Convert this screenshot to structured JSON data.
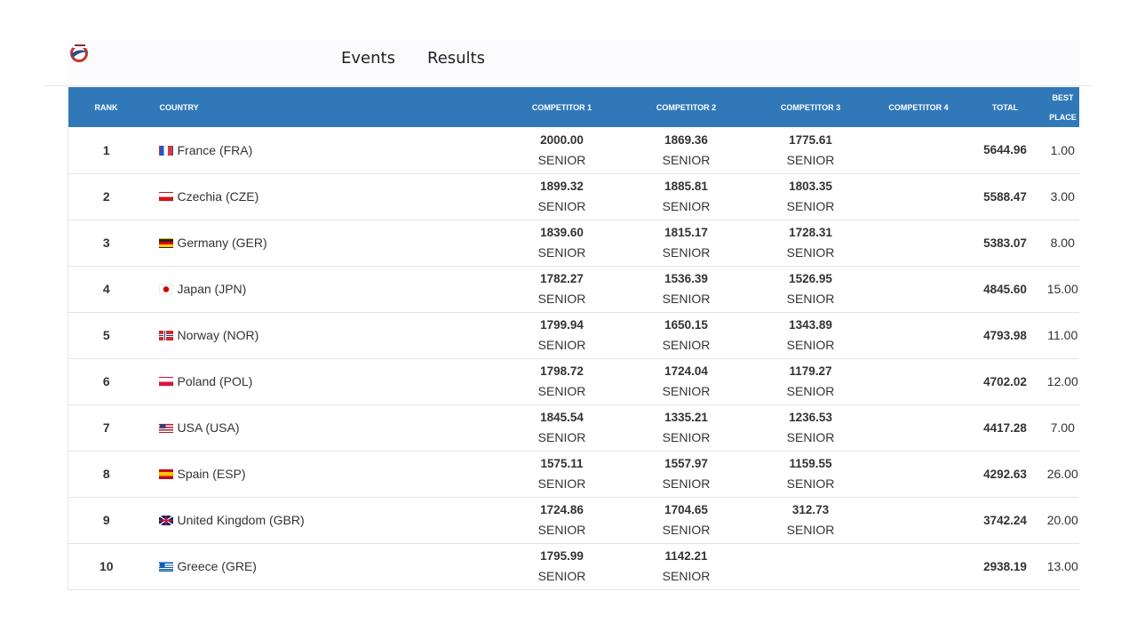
{
  "nav": {
    "logo_icon": "association-logo-icon",
    "events_label": "Events",
    "results_label": "Results"
  },
  "table": {
    "headers": {
      "rank": "RANK",
      "country": "COUNTRY",
      "competitor1": "COMPETITOR 1",
      "competitor2": "COMPETITOR 2",
      "competitor3": "COMPETITOR 3",
      "competitor4": "COMPETITOR 4",
      "total": "TOTAL",
      "best_line1": "BEST",
      "best_line2": "PLACE"
    },
    "header_color": "#3178b9",
    "rows": [
      {
        "rank": "1",
        "country": "France (FRA)",
        "flag": "flag-france-icon",
        "c1": {
          "score": "2000.00",
          "level": "SENIOR"
        },
        "c2": {
          "score": "1869.36",
          "level": "SENIOR"
        },
        "c3": {
          "score": "1775.61",
          "level": "SENIOR"
        },
        "total": "5644.96",
        "best": "1.00"
      },
      {
        "rank": "2",
        "country": "Czechia (CZE)",
        "flag": "flag-czechia-icon",
        "c1": {
          "score": "1899.32",
          "level": "SENIOR"
        },
        "c2": {
          "score": "1885.81",
          "level": "SENIOR"
        },
        "c3": {
          "score": "1803.35",
          "level": "SENIOR"
        },
        "total": "5588.47",
        "best": "3.00"
      },
      {
        "rank": "3",
        "country": "Germany (GER)",
        "flag": "flag-germany-icon",
        "c1": {
          "score": "1839.60",
          "level": "SENIOR"
        },
        "c2": {
          "score": "1815.17",
          "level": "SENIOR"
        },
        "c3": {
          "score": "1728.31",
          "level": "SENIOR"
        },
        "total": "5383.07",
        "best": "8.00"
      },
      {
        "rank": "4",
        "country": "Japan (JPN)",
        "flag": "flag-japan-icon",
        "c1": {
          "score": "1782.27",
          "level": "SENIOR"
        },
        "c2": {
          "score": "1536.39",
          "level": "SENIOR"
        },
        "c3": {
          "score": "1526.95",
          "level": "SENIOR"
        },
        "total": "4845.60",
        "best": "15.00"
      },
      {
        "rank": "5",
        "country": "Norway (NOR)",
        "flag": "flag-norway-icon",
        "c1": {
          "score": "1799.94",
          "level": "SENIOR"
        },
        "c2": {
          "score": "1650.15",
          "level": "SENIOR"
        },
        "c3": {
          "score": "1343.89",
          "level": "SENIOR"
        },
        "total": "4793.98",
        "best": "11.00"
      },
      {
        "rank": "6",
        "country": "Poland (POL)",
        "flag": "flag-poland-icon",
        "c1": {
          "score": "1798.72",
          "level": "SENIOR"
        },
        "c2": {
          "score": "1724.04",
          "level": "SENIOR"
        },
        "c3": {
          "score": "1179.27",
          "level": "SENIOR"
        },
        "total": "4702.02",
        "best": "12.00"
      },
      {
        "rank": "7",
        "country": "USA (USA)",
        "flag": "flag-usa-icon",
        "c1": {
          "score": "1845.54",
          "level": "SENIOR"
        },
        "c2": {
          "score": "1335.21",
          "level": "SENIOR"
        },
        "c3": {
          "score": "1236.53",
          "level": "SENIOR"
        },
        "total": "4417.28",
        "best": "7.00"
      },
      {
        "rank": "8",
        "country": "Spain (ESP)",
        "flag": "flag-spain-icon",
        "c1": {
          "score": "1575.11",
          "level": "SENIOR"
        },
        "c2": {
          "score": "1557.97",
          "level": "SENIOR"
        },
        "c3": {
          "score": "1159.55",
          "level": "SENIOR"
        },
        "total": "4292.63",
        "best": "26.00"
      },
      {
        "rank": "9",
        "country": "United Kingdom (GBR)",
        "flag": "flag-united-kingdom-icon",
        "c1": {
          "score": "1724.86",
          "level": "SENIOR"
        },
        "c2": {
          "score": "1704.65",
          "level": "SENIOR"
        },
        "c3": {
          "score": "312.73",
          "level": "SENIOR"
        },
        "total": "3742.24",
        "best": "20.00"
      },
      {
        "rank": "10",
        "country": "Greece (GRE)",
        "flag": "flag-greece-icon",
        "c1": {
          "score": "1795.99",
          "level": "SENIOR"
        },
        "c2": {
          "score": "1142.21",
          "level": "SENIOR"
        },
        "c3": {
          "score": "",
          "level": ""
        },
        "total": "2938.19",
        "best": "13.00"
      }
    ]
  }
}
